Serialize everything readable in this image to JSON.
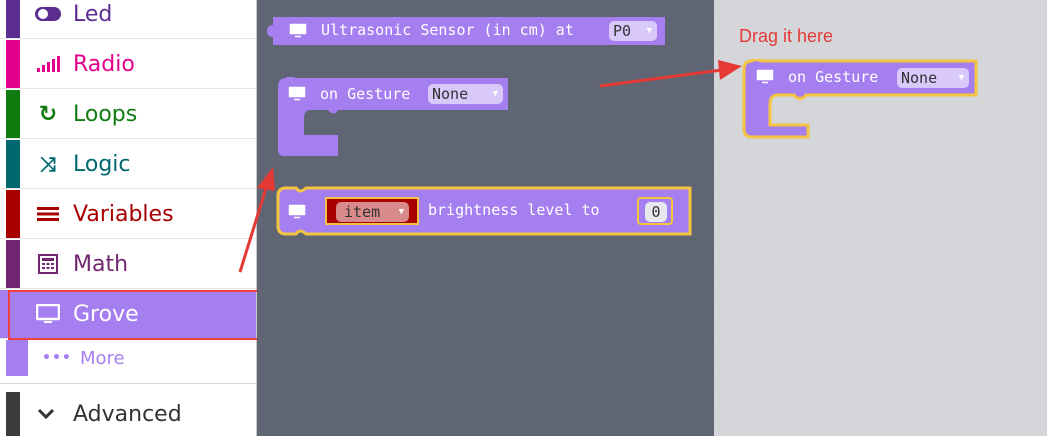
{
  "toolbox": {
    "categories": [
      {
        "label": "Led",
        "icon": "toggle-icon",
        "color": "#5c2d91"
      },
      {
        "label": "Radio",
        "icon": "signal-bars-icon",
        "color": "#e3008c"
      },
      {
        "label": "Loops",
        "icon": "loop-icon",
        "color": "#107c10"
      },
      {
        "label": "Logic",
        "icon": "shuffle-icon",
        "color": "#006970"
      },
      {
        "label": "Variables",
        "icon": "list-lines-icon",
        "color": "#a80000"
      },
      {
        "label": "Math",
        "icon": "calculator-icon",
        "color": "#712672"
      },
      {
        "label": "Grove",
        "icon": "monitor-icon",
        "color": "#a57ff0"
      }
    ],
    "more_label": "More",
    "advanced_label": "Advanced"
  },
  "flyout": {
    "ultrasonic": {
      "text": "Ultrasonic Sensor (in cm) at",
      "pin": "P0"
    },
    "gesture": {
      "text": "on Gesture",
      "value": "None"
    },
    "brightness": {
      "variable": "item",
      "text": "brightness level to",
      "number": "0"
    }
  },
  "workspace": {
    "annotation": "Drag it here",
    "gesture": {
      "text": "on Gesture",
      "value": "None"
    }
  },
  "colors": {
    "grove": "#a57ff0",
    "highlight": "#f5c542",
    "arrow": "#e53935",
    "variable": "#a80000"
  }
}
